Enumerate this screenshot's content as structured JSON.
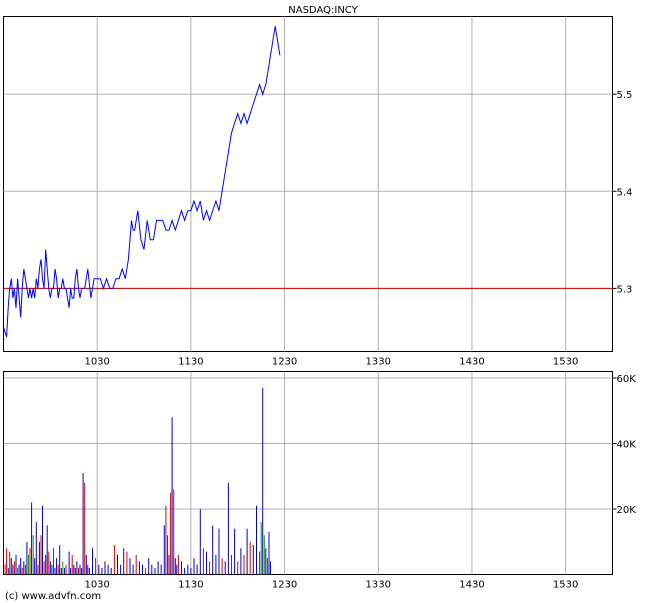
{
  "colors": {
    "price_line": "#0000ff",
    "reference_line": "#cc0000",
    "grid": "#b0b0b0",
    "frame": "#000000",
    "vol_up": "#00a000",
    "vol_down": "#dd0000",
    "vol_neutral": "#0000cc"
  },
  "footer": {
    "credit": "(c) www.advfn.com"
  },
  "chart_data": [
    {
      "type": "line",
      "title": "NASDAQ:INCY",
      "x_ticks": [
        "1030",
        "1130",
        "1230",
        "1330",
        "1430",
        "1530"
      ],
      "y_ticks": [
        "5.3",
        "5.4",
        "5.5"
      ],
      "xlim": [
        "09:30",
        "16:00"
      ],
      "ylim": [
        5.235,
        5.58
      ],
      "grid": true,
      "reference_line": {
        "y": 5.3
      },
      "series": [
        {
          "x": [
            "09:30",
            "09:32",
            "09:33",
            "09:34",
            "09:35",
            "09:36",
            "09:37",
            "09:38",
            "09:39",
            "09:40",
            "09:41",
            "09:42",
            "09:43",
            "09:44",
            "09:45",
            "09:46",
            "09:47",
            "09:48",
            "09:49",
            "09:50",
            "09:51",
            "09:52",
            "09:53",
            "09:54",
            "09:55",
            "09:56",
            "09:57",
            "09:58",
            "09:59",
            "10:00",
            "10:01",
            "10:02",
            "10:03",
            "10:04",
            "10:05",
            "10:06",
            "10:07",
            "10:08",
            "10:09",
            "10:10",
            "10:11",
            "10:12",
            "10:13",
            "10:14",
            "10:15",
            "10:16",
            "10:17",
            "10:18",
            "10:19",
            "10:20",
            "10:21",
            "10:22",
            "10:24",
            "10:26",
            "10:28",
            "10:30",
            "10:32",
            "10:34",
            "10:36",
            "10:38",
            "10:40",
            "10:42",
            "10:44",
            "10:46",
            "10:48",
            "10:50",
            "10:52",
            "10:53",
            "10:54",
            "10:55",
            "10:56",
            "10:58",
            "11:00",
            "11:02",
            "11:04",
            "11:06",
            "11:08",
            "11:10",
            "11:12",
            "11:14",
            "11:16",
            "11:18",
            "11:20",
            "11:22",
            "11:24",
            "11:26",
            "11:28",
            "11:30",
            "11:32",
            "11:34",
            "11:36",
            "11:38",
            "11:40",
            "11:42",
            "11:44",
            "11:46",
            "11:48",
            "11:50",
            "11:52",
            "11:54",
            "11:56",
            "11:58",
            "12:00",
            "12:02",
            "12:04",
            "12:06",
            "12:08",
            "12:10",
            "12:12",
            "12:14",
            "12:16",
            "12:18",
            "12:19",
            "12:20",
            "12:21",
            "12:22",
            "12:23",
            "12:24",
            "12:25",
            "12:26",
            "12:27"
          ],
          "values": [
            5.26,
            5.25,
            5.28,
            5.3,
            5.31,
            5.29,
            5.3,
            5.28,
            5.31,
            5.29,
            5.27,
            5.3,
            5.32,
            5.31,
            5.3,
            5.29,
            5.3,
            5.29,
            5.3,
            5.29,
            5.31,
            5.3,
            5.32,
            5.33,
            5.31,
            5.3,
            5.34,
            5.32,
            5.3,
            5.29,
            5.3,
            5.3,
            5.32,
            5.31,
            5.29,
            5.3,
            5.3,
            5.31,
            5.3,
            5.3,
            5.29,
            5.28,
            5.3,
            5.29,
            5.29,
            5.31,
            5.32,
            5.3,
            5.29,
            5.3,
            5.3,
            5.3,
            5.32,
            5.29,
            5.31,
            5.31,
            5.31,
            5.3,
            5.31,
            5.3,
            5.3,
            5.31,
            5.31,
            5.32,
            5.31,
            5.33,
            5.37,
            5.36,
            5.36,
            5.37,
            5.38,
            5.35,
            5.34,
            5.37,
            5.35,
            5.35,
            5.37,
            5.37,
            5.37,
            5.36,
            5.36,
            5.37,
            5.36,
            5.37,
            5.38,
            5.37,
            5.38,
            5.38,
            5.39,
            5.38,
            5.39,
            5.37,
            5.38,
            5.37,
            5.38,
            5.39,
            5.38,
            5.4,
            5.42,
            5.44,
            5.46,
            5.47,
            5.48,
            5.47,
            5.48,
            5.47,
            5.48,
            5.49,
            5.5,
            5.51,
            5.5,
            5.51,
            5.52,
            5.53,
            5.54,
            5.55,
            5.56,
            5.57,
            5.56,
            5.55,
            5.54
          ]
        }
      ]
    },
    {
      "type": "bar",
      "x_ticks": [
        "1030",
        "1130",
        "1230",
        "1330",
        "1430",
        "1530"
      ],
      "y_ticks": [
        "20K",
        "40K",
        "60K"
      ],
      "ylim": [
        0,
        62000
      ],
      "grid": true,
      "bars": [
        {
          "x": "09:30",
          "v": 18000,
          "c": "neutral"
        },
        {
          "x": "09:31",
          "v": 3000,
          "c": "down"
        },
        {
          "x": "09:32",
          "v": 8000,
          "c": "down"
        },
        {
          "x": "09:33",
          "v": 2000,
          "c": "neutral"
        },
        {
          "x": "09:34",
          "v": 7000,
          "c": "down"
        },
        {
          "x": "09:35",
          "v": 5000,
          "c": "neutral"
        },
        {
          "x": "09:36",
          "v": 3000,
          "c": "neutral"
        },
        {
          "x": "09:37",
          "v": 4000,
          "c": "down"
        },
        {
          "x": "09:38",
          "v": 6000,
          "c": "neutral"
        },
        {
          "x": "09:39",
          "v": 2000,
          "c": "up"
        },
        {
          "x": "09:40",
          "v": 3000,
          "c": "neutral"
        },
        {
          "x": "09:41",
          "v": 5000,
          "c": "neutral"
        },
        {
          "x": "09:42",
          "v": 2000,
          "c": "down"
        },
        {
          "x": "09:43",
          "v": 4000,
          "c": "neutral"
        },
        {
          "x": "09:44",
          "v": 3000,
          "c": "down"
        },
        {
          "x": "09:45",
          "v": 10000,
          "c": "neutral"
        },
        {
          "x": "09:46",
          "v": 6000,
          "c": "up"
        },
        {
          "x": "09:47",
          "v": 8000,
          "c": "down"
        },
        {
          "x": "09:48",
          "v": 22000,
          "c": "neutral"
        },
        {
          "x": "09:49",
          "v": 12000,
          "c": "up"
        },
        {
          "x": "09:50",
          "v": 5000,
          "c": "neutral"
        },
        {
          "x": "09:51",
          "v": 16000,
          "c": "neutral"
        },
        {
          "x": "09:52",
          "v": 3000,
          "c": "down"
        },
        {
          "x": "09:53",
          "v": 10000,
          "c": "neutral"
        },
        {
          "x": "09:54",
          "v": 12000,
          "c": "down"
        },
        {
          "x": "09:55",
          "v": 21000,
          "c": "neutral"
        },
        {
          "x": "09:56",
          "v": 4000,
          "c": "down"
        },
        {
          "x": "09:57",
          "v": 6000,
          "c": "neutral"
        },
        {
          "x": "09:58",
          "v": 15000,
          "c": "neutral"
        },
        {
          "x": "09:59",
          "v": 7000,
          "c": "down"
        },
        {
          "x": "10:00",
          "v": 4000,
          "c": "neutral"
        },
        {
          "x": "10:01",
          "v": 3000,
          "c": "neutral"
        },
        {
          "x": "10:02",
          "v": 8000,
          "c": "down"
        },
        {
          "x": "10:03",
          "v": 2000,
          "c": "neutral"
        },
        {
          "x": "10:04",
          "v": 5000,
          "c": "neutral"
        },
        {
          "x": "10:05",
          "v": 3000,
          "c": "down"
        },
        {
          "x": "10:06",
          "v": 9000,
          "c": "neutral"
        },
        {
          "x": "10:07",
          "v": 2000,
          "c": "neutral"
        },
        {
          "x": "10:08",
          "v": 4000,
          "c": "up"
        },
        {
          "x": "10:09",
          "v": 2000,
          "c": "neutral"
        },
        {
          "x": "10:10",
          "v": 3000,
          "c": "down"
        },
        {
          "x": "10:12",
          "v": 7000,
          "c": "neutral"
        },
        {
          "x": "10:13",
          "v": 2000,
          "c": "neutral"
        },
        {
          "x": "10:14",
          "v": 6000,
          "c": "down"
        },
        {
          "x": "10:15",
          "v": 3000,
          "c": "neutral"
        },
        {
          "x": "10:16",
          "v": 2000,
          "c": "neutral"
        },
        {
          "x": "10:17",
          "v": 4000,
          "c": "neutral"
        },
        {
          "x": "10:18",
          "v": 2000,
          "c": "down"
        },
        {
          "x": "10:19",
          "v": 3000,
          "c": "neutral"
        },
        {
          "x": "10:20",
          "v": 2000,
          "c": "neutral"
        },
        {
          "x": "10:21",
          "v": 31000,
          "c": "neutral"
        },
        {
          "x": "10:22",
          "v": 28000,
          "c": "down"
        },
        {
          "x": "10:23",
          "v": 6000,
          "c": "neutral"
        },
        {
          "x": "10:24",
          "v": 3000,
          "c": "neutral"
        },
        {
          "x": "10:25",
          "v": 2000,
          "c": "neutral"
        },
        {
          "x": "10:27",
          "v": 8000,
          "c": "neutral"
        },
        {
          "x": "10:29",
          "v": 5000,
          "c": "down"
        },
        {
          "x": "10:31",
          "v": 3000,
          "c": "neutral"
        },
        {
          "x": "10:33",
          "v": 2000,
          "c": "neutral"
        },
        {
          "x": "10:35",
          "v": 4000,
          "c": "neutral"
        },
        {
          "x": "10:37",
          "v": 3000,
          "c": "neutral"
        },
        {
          "x": "10:39",
          "v": 2000,
          "c": "neutral"
        },
        {
          "x": "10:41",
          "v": 9000,
          "c": "down"
        },
        {
          "x": "10:43",
          "v": 6000,
          "c": "neutral"
        },
        {
          "x": "10:45",
          "v": 3000,
          "c": "neutral"
        },
        {
          "x": "10:47",
          "v": 8000,
          "c": "neutral"
        },
        {
          "x": "10:49",
          "v": 7000,
          "c": "down"
        },
        {
          "x": "10:51",
          "v": 5000,
          "c": "neutral"
        },
        {
          "x": "10:53",
          "v": 3000,
          "c": "neutral"
        },
        {
          "x": "10:55",
          "v": 6000,
          "c": "down"
        },
        {
          "x": "10:57",
          "v": 4000,
          "c": "neutral"
        },
        {
          "x": "10:59",
          "v": 3000,
          "c": "neutral"
        },
        {
          "x": "11:01",
          "v": 2000,
          "c": "down"
        },
        {
          "x": "11:03",
          "v": 5000,
          "c": "neutral"
        },
        {
          "x": "11:05",
          "v": 3000,
          "c": "neutral"
        },
        {
          "x": "11:07",
          "v": 2000,
          "c": "neutral"
        },
        {
          "x": "11:09",
          "v": 4000,
          "c": "neutral"
        },
        {
          "x": "11:11",
          "v": 3000,
          "c": "neutral"
        },
        {
          "x": "11:13",
          "v": 15000,
          "c": "neutral"
        },
        {
          "x": "11:14",
          "v": 21000,
          "c": "down"
        },
        {
          "x": "11:15",
          "v": 12000,
          "c": "down"
        },
        {
          "x": "11:16",
          "v": 6000,
          "c": "neutral"
        },
        {
          "x": "11:17",
          "v": 25000,
          "c": "down"
        },
        {
          "x": "11:18",
          "v": 48000,
          "c": "neutral"
        },
        {
          "x": "11:19",
          "v": 26000,
          "c": "down"
        },
        {
          "x": "11:20",
          "v": 5000,
          "c": "neutral"
        },
        {
          "x": "11:21",
          "v": 3000,
          "c": "neutral"
        },
        {
          "x": "11:22",
          "v": 6000,
          "c": "down"
        },
        {
          "x": "11:24",
          "v": 4000,
          "c": "neutral"
        },
        {
          "x": "11:26",
          "v": 2000,
          "c": "neutral"
        },
        {
          "x": "11:28",
          "v": 3000,
          "c": "neutral"
        },
        {
          "x": "11:30",
          "v": 2000,
          "c": "neutral"
        },
        {
          "x": "11:32",
          "v": 5000,
          "c": "neutral"
        },
        {
          "x": "11:34",
          "v": 3000,
          "c": "neutral"
        },
        {
          "x": "11:36",
          "v": 20000,
          "c": "neutral"
        },
        {
          "x": "11:38",
          "v": 8000,
          "c": "down"
        },
        {
          "x": "11:40",
          "v": 7000,
          "c": "neutral"
        },
        {
          "x": "11:42",
          "v": 4000,
          "c": "down"
        },
        {
          "x": "11:44",
          "v": 15000,
          "c": "neutral"
        },
        {
          "x": "11:46",
          "v": 6000,
          "c": "neutral"
        },
        {
          "x": "11:48",
          "v": 14000,
          "c": "neutral"
        },
        {
          "x": "11:50",
          "v": 5000,
          "c": "down"
        },
        {
          "x": "11:52",
          "v": 4000,
          "c": "neutral"
        },
        {
          "x": "11:54",
          "v": 28000,
          "c": "neutral"
        },
        {
          "x": "11:56",
          "v": 6000,
          "c": "down"
        },
        {
          "x": "11:58",
          "v": 14000,
          "c": "neutral"
        },
        {
          "x": "12:00",
          "v": 4000,
          "c": "down"
        },
        {
          "x": "12:02",
          "v": 8000,
          "c": "neutral"
        },
        {
          "x": "12:04",
          "v": 6000,
          "c": "down"
        },
        {
          "x": "12:06",
          "v": 14000,
          "c": "neutral"
        },
        {
          "x": "12:08",
          "v": 10000,
          "c": "down"
        },
        {
          "x": "12:10",
          "v": 9000,
          "c": "neutral"
        },
        {
          "x": "12:12",
          "v": 21000,
          "c": "neutral"
        },
        {
          "x": "12:14",
          "v": 7000,
          "c": "down"
        },
        {
          "x": "12:15",
          "v": 16000,
          "c": "up"
        },
        {
          "x": "12:16",
          "v": 57000,
          "c": "neutral"
        },
        {
          "x": "12:17",
          "v": 12000,
          "c": "up"
        },
        {
          "x": "12:18",
          "v": 8000,
          "c": "neutral"
        },
        {
          "x": "12:19",
          "v": 5000,
          "c": "down"
        },
        {
          "x": "12:20",
          "v": 13000,
          "c": "neutral"
        },
        {
          "x": "12:21",
          "v": 4000,
          "c": "neutral"
        }
      ]
    }
  ]
}
